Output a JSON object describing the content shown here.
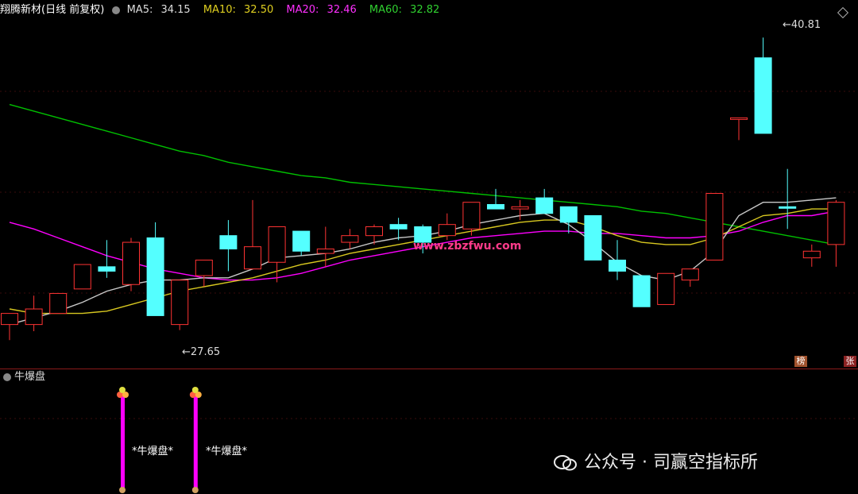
{
  "header": {
    "stock_name": "翔腾新材",
    "period": "(日线 前复权)",
    "ma5_label": "MA5:",
    "ma5_value": "34.15",
    "ma10_label": "MA10:",
    "ma10_value": "32.50",
    "ma20_label": "MA20:",
    "ma20_value": "32.46",
    "ma60_label": "MA60:",
    "ma60_value": "32.82"
  },
  "colors": {
    "up_candle": "#ff3333",
    "down_candle": "#54ffff",
    "ma5": "#c8c8c8",
    "ma10": "#d8c820",
    "ma20": "#ff00ff",
    "ma60": "#00c000",
    "signal_bar": "#ff00ff",
    "grid": "#8b1a1a"
  },
  "chart_data": {
    "type": "candlestick",
    "price_high_label": "40.81",
    "price_low_label": "27.65",
    "price_high_arrow": "←",
    "price_low_arrow": "←",
    "candles": [
      {
        "o": 27.9,
        "h": 28.4,
        "l": 27.2,
        "c": 28.4,
        "dir": "up"
      },
      {
        "o": 27.9,
        "h": 29.2,
        "l": 27.6,
        "c": 28.6,
        "dir": "up"
      },
      {
        "o": 28.4,
        "h": 29.3,
        "l": 28.4,
        "c": 29.3,
        "dir": "up"
      },
      {
        "o": 29.5,
        "h": 30.6,
        "l": 29.5,
        "c": 30.6,
        "dir": "up"
      },
      {
        "o": 30.5,
        "h": 31.7,
        "l": 30.0,
        "c": 30.3,
        "dir": "down"
      },
      {
        "o": 29.7,
        "h": 31.8,
        "l": 29.4,
        "c": 31.6,
        "dir": "up"
      },
      {
        "o": 31.8,
        "h": 32.5,
        "l": 28.3,
        "c": 28.3,
        "dir": "down"
      },
      {
        "o": 27.9,
        "h": 29.9,
        "l": 27.65,
        "c": 29.9,
        "dir": "up"
      },
      {
        "o": 30.1,
        "h": 30.8,
        "l": 29.6,
        "c": 30.8,
        "dir": "up"
      },
      {
        "o": 31.9,
        "h": 32.6,
        "l": 30.3,
        "c": 31.3,
        "dir": "down"
      },
      {
        "o": 30.4,
        "h": 33.5,
        "l": 30.4,
        "c": 31.4,
        "dir": "up"
      },
      {
        "o": 30.7,
        "h": 32.3,
        "l": 29.8,
        "c": 32.3,
        "dir": "up"
      },
      {
        "o": 32.1,
        "h": 32.1,
        "l": 31.0,
        "c": 31.2,
        "dir": "down"
      },
      {
        "o": 31.1,
        "h": 32.3,
        "l": 30.5,
        "c": 31.3,
        "dir": "up"
      },
      {
        "o": 31.6,
        "h": 32.2,
        "l": 31.3,
        "c": 31.9,
        "dir": "up"
      },
      {
        "o": 31.9,
        "h": 32.4,
        "l": 31.5,
        "c": 32.3,
        "dir": "up"
      },
      {
        "o": 32.4,
        "h": 32.7,
        "l": 31.7,
        "c": 32.2,
        "dir": "down"
      },
      {
        "o": 31.6,
        "h": 32.4,
        "l": 31.1,
        "c": 32.3,
        "dir": "down"
      },
      {
        "o": 31.9,
        "h": 32.9,
        "l": 31.7,
        "c": 32.4,
        "dir": "up"
      },
      {
        "o": 32.2,
        "h": 33.4,
        "l": 31.9,
        "c": 33.4,
        "dir": "up"
      },
      {
        "o": 33.3,
        "h": 34.0,
        "l": 33.1,
        "c": 33.1,
        "dir": "down"
      },
      {
        "o": 33.1,
        "h": 33.5,
        "l": 32.6,
        "c": 33.2,
        "dir": "up"
      },
      {
        "o": 33.6,
        "h": 34.0,
        "l": 33.0,
        "c": 32.9,
        "dir": "down"
      },
      {
        "o": 33.2,
        "h": 33.2,
        "l": 32.0,
        "c": 32.5,
        "dir": "down"
      },
      {
        "o": 32.8,
        "h": 32.8,
        "l": 30.8,
        "c": 30.8,
        "dir": "down"
      },
      {
        "o": 30.8,
        "h": 31.7,
        "l": 29.9,
        "c": 30.3,
        "dir": "down"
      },
      {
        "o": 30.1,
        "h": 30.1,
        "l": 28.7,
        "c": 28.7,
        "dir": "down"
      },
      {
        "o": 28.8,
        "h": 30.2,
        "l": 28.8,
        "c": 30.2,
        "dir": "up"
      },
      {
        "o": 29.9,
        "h": 30.4,
        "l": 29.6,
        "c": 30.4,
        "dir": "up"
      },
      {
        "o": 30.8,
        "h": 33.8,
        "l": 30.8,
        "c": 33.8,
        "dir": "up"
      },
      {
        "o": 37.2,
        "h": 37.2,
        "l": 36.2,
        "c": 37.2,
        "dir": "up"
      },
      {
        "o": 36.5,
        "h": 40.81,
        "l": 36.5,
        "c": 39.9,
        "dir": "down"
      },
      {
        "o": 33.2,
        "h": 34.9,
        "l": 32.2,
        "c": 33.2,
        "dir": "down"
      },
      {
        "o": 30.9,
        "h": 31.5,
        "l": 30.5,
        "c": 31.2,
        "dir": "up"
      },
      {
        "o": 31.5,
        "h": 33.5,
        "l": 30.5,
        "c": 33.4,
        "dir": "up"
      }
    ],
    "ma5": [
      27.9,
      28.2,
      28.5,
      28.9,
      29.4,
      29.7,
      29.9,
      29.9,
      30.0,
      30.0,
      30.4,
      30.9,
      31.0,
      31.1,
      31.3,
      31.6,
      31.8,
      31.9,
      32.1,
      32.4,
      32.6,
      32.8,
      32.9,
      32.4,
      31.6,
      30.7,
      30.1,
      29.9,
      30.3,
      31.2,
      32.8,
      33.4,
      33.4,
      33.5,
      33.6
    ],
    "ma10": [
      28.6,
      28.4,
      28.4,
      28.4,
      28.5,
      28.8,
      29.1,
      29.4,
      29.6,
      29.8,
      30.0,
      30.3,
      30.6,
      30.8,
      31.1,
      31.3,
      31.5,
      31.7,
      31.9,
      32.1,
      32.3,
      32.5,
      32.6,
      32.6,
      32.3,
      31.9,
      31.6,
      31.5,
      31.5,
      31.8,
      32.3,
      32.8,
      32.9,
      33.1,
      33.1
    ],
    "ma20": [
      32.5,
      32.2,
      31.8,
      31.4,
      31.0,
      30.7,
      30.4,
      30.2,
      30.0,
      29.9,
      29.9,
      30.0,
      30.2,
      30.5,
      30.8,
      31.0,
      31.2,
      31.4,
      31.6,
      31.8,
      31.9,
      32.0,
      32.1,
      32.1,
      32.0,
      32.0,
      31.9,
      31.8,
      31.8,
      31.9,
      32.1,
      32.5,
      32.8,
      32.8,
      33.0
    ],
    "ma60": [
      37.8,
      37.5,
      37.2,
      36.9,
      36.6,
      36.3,
      36.0,
      35.7,
      35.5,
      35.2,
      35.0,
      34.8,
      34.6,
      34.5,
      34.3,
      34.2,
      34.1,
      34.0,
      33.9,
      33.8,
      33.7,
      33.6,
      33.5,
      33.4,
      33.3,
      33.2,
      33.0,
      32.9,
      32.7,
      32.5,
      32.3,
      32.1,
      31.9,
      31.7,
      31.5
    ],
    "ylim": [
      26.6,
      41.5
    ]
  },
  "indicator": {
    "title": "牛爆盘",
    "signal_label": "*牛爆盘*",
    "signals": [
      {
        "candle_index": 5
      },
      {
        "candle_index": 8
      }
    ]
  },
  "badges": {
    "badge1": "榜",
    "badge2": "张"
  },
  "watermark": {
    "wechat_text": "公众号 · 司赢空指标所",
    "site_text": "www.zbzfwu.com"
  }
}
